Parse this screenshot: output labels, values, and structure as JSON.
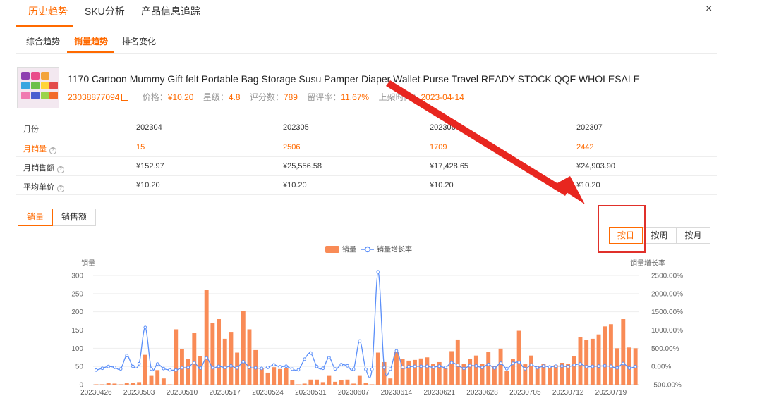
{
  "tabs": [
    "历史趋势",
    "SKU分析",
    "产品信息追踪"
  ],
  "close_label": "×",
  "subtabs": [
    "综合趋势",
    "销量趋势",
    "排名变化"
  ],
  "product": {
    "title": "1170 Cartoon Mummy Gift felt Portable Bag Storage Susu Pamper Diaper Wallet Purse Travel READY STOCK QQF WHOLESALE",
    "id": "23038877094",
    "price_label": "价格：",
    "price": "¥10.20",
    "rating_label": "星级：",
    "rating": "4.8",
    "reviews_label": "评分数：",
    "reviews": "789",
    "retention_label": "留评率：",
    "retention": "11.67%",
    "listed_label": "上架时间：",
    "listed": "2023-04-14"
  },
  "stats": {
    "month_label": "月份",
    "months": [
      "202304",
      "202305",
      "202306",
      "202307"
    ],
    "sales_label": "月销量",
    "sales": [
      "15",
      "2506",
      "1709",
      "2442"
    ],
    "revenue_label": "月销售额",
    "revenue": [
      "¥152.97",
      "¥25,556.58",
      "¥17,428.65",
      "¥24,903.90"
    ],
    "avg_label": "平均单价",
    "avg": [
      "¥10.20",
      "¥10.20",
      "¥10.20",
      "¥10.20"
    ]
  },
  "metric_toggle": [
    "销量",
    "销售额"
  ],
  "period_toggle": [
    "按日",
    "按周",
    "按月"
  ],
  "colors": {
    "accent": "#ff6a00",
    "bar": "#f98b56",
    "line": "#5b8ff9",
    "annotation": "#e0302a"
  },
  "chart_data": {
    "type": "bar",
    "legend": [
      "销量",
      "销量增长率"
    ],
    "ylabel": "销量",
    "y2label": "销量增长率",
    "ylim": [
      0,
      300
    ],
    "yticks": [
      0,
      50,
      100,
      150,
      200,
      250,
      300
    ],
    "y2lim": [
      -500,
      2500
    ],
    "y2ticks": [
      "-500.00%",
      "0.00%",
      "500.00%",
      "1000.00%",
      "1500.00%",
      "2000.00%",
      "2500.00%"
    ],
    "xticks": [
      "20230426",
      "20230503",
      "20230510",
      "20230517",
      "20230524",
      "20230531",
      "20230607",
      "20230614",
      "20230621",
      "20230628",
      "20230705",
      "20230712",
      "20230719"
    ],
    "series": [
      {
        "name": "销量",
        "values": [
          1,
          1,
          4,
          3,
          1,
          4,
          4,
          7,
          82,
          24,
          40,
          17,
          1,
          152,
          98,
          71,
          142,
          78,
          260,
          170,
          180,
          126,
          145,
          88,
          202,
          152,
          95,
          44,
          33,
          48,
          43,
          46,
          13,
          1,
          3,
          14,
          14,
          7,
          24,
          8,
          12,
          14,
          3,
          24,
          5,
          1,
          88,
          62,
          17,
          90,
          70,
          66,
          68,
          72,
          75,
          57,
          62,
          45,
          92,
          124,
          58,
          70,
          80,
          57,
          89,
          52,
          99,
          38,
          70,
          148,
          56,
          80,
          52,
          57,
          50,
          54,
          60,
          57,
          78,
          130,
          123,
          126,
          138,
          160,
          166,
          100,
          180,
          102,
          100
        ]
      },
      {
        "name": "销量增长率",
        "values": [
          -100,
          -50,
          0,
          -25,
          -67,
          300,
          0,
          75,
          1071,
          -71,
          67,
          -58,
          -94,
          -100,
          -36,
          -28,
          100,
          -45,
          233,
          -35,
          6,
          -30,
          15,
          -39,
          130,
          -25,
          -38,
          -54,
          -25,
          45,
          -10,
          7,
          -72,
          -92,
          200,
          367,
          0,
          -50,
          243,
          -67,
          50,
          17,
          -79,
          700,
          -79,
          -80,
          2600,
          -30,
          -73,
          429,
          -22,
          -6,
          3,
          6,
          4,
          -24,
          9,
          -27,
          104,
          35,
          -53,
          21,
          14,
          -29,
          56,
          -42,
          90,
          -62,
          84,
          111,
          -62,
          43,
          -35,
          10,
          -12,
          8,
          11,
          -5,
          37,
          67,
          -5,
          2,
          10,
          16,
          4,
          -40,
          80,
          -43,
          -2
        ]
      }
    ]
  }
}
